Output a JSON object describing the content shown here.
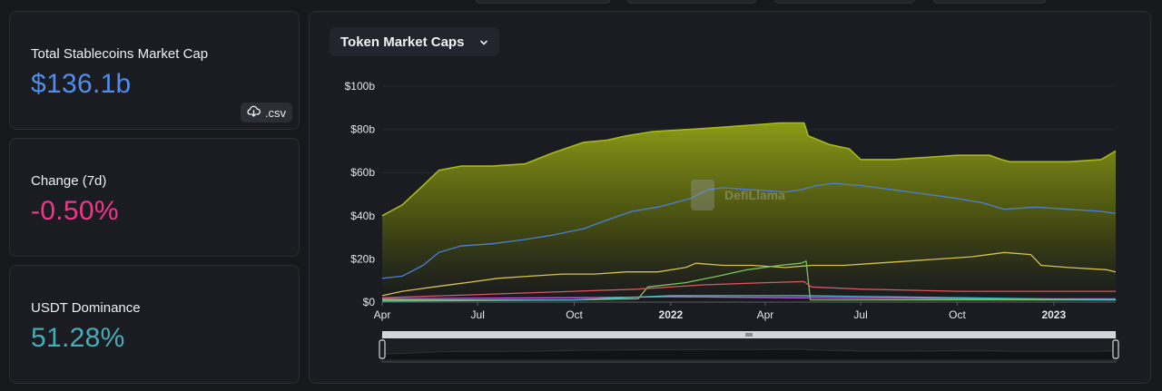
{
  "stats": {
    "total_label": "Total Stablecoins Market Cap",
    "total_value": "$136.1b",
    "csv_label": ".csv",
    "change_label": "Change (7d)",
    "change_value": "-0.50%",
    "dominance_label": "USDT Dominance",
    "dominance_value": "51.28%"
  },
  "colors": {
    "total_value": "#4f8fea",
    "change_value": "#f0358b",
    "dominance_value": "#46acb7"
  },
  "chart": {
    "dropdown_label": "Token Market Caps",
    "watermark": "DefiLlama"
  },
  "chart_data": {
    "type": "area",
    "title": "",
    "xlabel": "",
    "ylabel": "",
    "ylim": [
      0,
      100
    ],
    "y_unit": "b",
    "y_ticks": [
      "$0",
      "$20b",
      "$40b",
      "$60b",
      "$80b",
      "$100b"
    ],
    "y_tick_values": [
      0,
      20,
      40,
      60,
      80,
      100
    ],
    "x_ticks": [
      "Apr",
      "Jul",
      "Oct",
      "2022",
      "Apr",
      "Jul",
      "Oct",
      "2023"
    ],
    "x_tick_dates": [
      "2021-04-01",
      "2021-07-01",
      "2021-10-01",
      "2022-01-01",
      "2022-04-01",
      "2022-07-01",
      "2022-10-01",
      "2023-01-01"
    ],
    "x_range": [
      "2021-04-01",
      "2023-03-01"
    ],
    "grid": true,
    "legend": "none",
    "series": [
      {
        "color": "#a6b81e",
        "fill": true,
        "points": [
          [
            "2021-04-01",
            40
          ],
          [
            "2021-04-20",
            45
          ],
          [
            "2021-05-10",
            54
          ],
          [
            "2021-05-25",
            61
          ],
          [
            "2021-06-15",
            63
          ],
          [
            "2021-07-15",
            63
          ],
          [
            "2021-08-15",
            64
          ],
          [
            "2021-09-10",
            69
          ],
          [
            "2021-10-10",
            74
          ],
          [
            "2021-11-01",
            75
          ],
          [
            "2021-11-20",
            77
          ],
          [
            "2021-12-15",
            79
          ],
          [
            "2022-01-20",
            80
          ],
          [
            "2022-02-20",
            81
          ],
          [
            "2022-03-20",
            82
          ],
          [
            "2022-04-15",
            83
          ],
          [
            "2022-05-08",
            83
          ],
          [
            "2022-05-12",
            77
          ],
          [
            "2022-06-01",
            73
          ],
          [
            "2022-06-20",
            71
          ],
          [
            "2022-07-01",
            66
          ],
          [
            "2022-08-01",
            66
          ],
          [
            "2022-09-01",
            67
          ],
          [
            "2022-10-01",
            68
          ],
          [
            "2022-11-01",
            68
          ],
          [
            "2022-11-12",
            66
          ],
          [
            "2022-11-20",
            65
          ],
          [
            "2022-12-15",
            65
          ],
          [
            "2023-01-15",
            65
          ],
          [
            "2023-02-15",
            66
          ],
          [
            "2023-03-01",
            70
          ]
        ]
      },
      {
        "color": "#4d7ed8",
        "fill": false,
        "points": [
          [
            "2021-04-01",
            11
          ],
          [
            "2021-04-20",
            12
          ],
          [
            "2021-05-10",
            17
          ],
          [
            "2021-05-25",
            23
          ],
          [
            "2021-06-15",
            26
          ],
          [
            "2021-07-15",
            27
          ],
          [
            "2021-08-15",
            29
          ],
          [
            "2021-09-10",
            31
          ],
          [
            "2021-10-10",
            34
          ],
          [
            "2021-11-01",
            38
          ],
          [
            "2021-11-25",
            42
          ],
          [
            "2021-12-20",
            44
          ],
          [
            "2022-01-20",
            48
          ],
          [
            "2022-02-05",
            52
          ],
          [
            "2022-02-20",
            53
          ],
          [
            "2022-03-20",
            52
          ],
          [
            "2022-04-20",
            51
          ],
          [
            "2022-05-05",
            52
          ],
          [
            "2022-05-20",
            54
          ],
          [
            "2022-06-05",
            55
          ],
          [
            "2022-07-01",
            54
          ],
          [
            "2022-08-01",
            52
          ],
          [
            "2022-09-01",
            50
          ],
          [
            "2022-10-01",
            48
          ],
          [
            "2022-10-25",
            46
          ],
          [
            "2022-11-15",
            43
          ],
          [
            "2022-12-15",
            44
          ],
          [
            "2023-01-15",
            43
          ],
          [
            "2023-02-15",
            42
          ],
          [
            "2023-03-01",
            41
          ]
        ]
      },
      {
        "color": "#d6c24a",
        "fill": false,
        "points": [
          [
            "2021-04-01",
            3
          ],
          [
            "2021-04-20",
            5
          ],
          [
            "2021-05-20",
            7
          ],
          [
            "2021-06-20",
            9
          ],
          [
            "2021-07-20",
            11
          ],
          [
            "2021-08-20",
            12
          ],
          [
            "2021-09-20",
            13
          ],
          [
            "2021-10-20",
            13
          ],
          [
            "2021-11-20",
            14
          ],
          [
            "2021-12-20",
            14
          ],
          [
            "2022-01-15",
            16
          ],
          [
            "2022-01-25",
            18
          ],
          [
            "2022-02-20",
            17
          ],
          [
            "2022-03-20",
            17
          ],
          [
            "2022-04-20",
            16
          ],
          [
            "2022-05-15",
            17
          ],
          [
            "2022-06-15",
            17
          ],
          [
            "2022-07-15",
            18
          ],
          [
            "2022-08-15",
            19
          ],
          [
            "2022-09-15",
            20
          ],
          [
            "2022-10-15",
            21
          ],
          [
            "2022-11-15",
            23
          ],
          [
            "2022-12-10",
            22
          ],
          [
            "2022-12-20",
            17
          ],
          [
            "2023-01-15",
            16
          ],
          [
            "2023-02-20",
            15
          ],
          [
            "2023-03-01",
            14
          ]
        ]
      },
      {
        "color": "#7cc45c",
        "fill": false,
        "points": [
          [
            "2021-04-01",
            1
          ],
          [
            "2021-07-01",
            1
          ],
          [
            "2021-10-01",
            1
          ],
          [
            "2021-12-01",
            1.5
          ],
          [
            "2021-12-10",
            7
          ],
          [
            "2022-01-15",
            9
          ],
          [
            "2022-02-15",
            12
          ],
          [
            "2022-03-15",
            15
          ],
          [
            "2022-04-15",
            17
          ],
          [
            "2022-05-05",
            18
          ],
          [
            "2022-05-10",
            19
          ],
          [
            "2022-05-14",
            1
          ],
          [
            "2022-07-01",
            1
          ],
          [
            "2022-10-01",
            1
          ],
          [
            "2023-03-01",
            1
          ]
        ]
      },
      {
        "color": "#d9575f",
        "fill": false,
        "points": [
          [
            "2021-04-01",
            2
          ],
          [
            "2021-06-01",
            3
          ],
          [
            "2021-08-01",
            4
          ],
          [
            "2021-10-01",
            5
          ],
          [
            "2021-12-01",
            6
          ],
          [
            "2022-02-01",
            8
          ],
          [
            "2022-04-01",
            9
          ],
          [
            "2022-05-08",
            9.5
          ],
          [
            "2022-05-15",
            7
          ],
          [
            "2022-07-01",
            6
          ],
          [
            "2022-10-01",
            5
          ],
          [
            "2023-03-01",
            5
          ]
        ]
      },
      {
        "color": "#c75fe0",
        "fill": false,
        "points": [
          [
            "2021-04-01",
            1.5
          ],
          [
            "2021-10-01",
            2
          ],
          [
            "2022-01-01",
            2.5
          ],
          [
            "2022-05-01",
            2
          ],
          [
            "2022-10-01",
            1.5
          ],
          [
            "2023-03-01",
            1.5
          ]
        ]
      },
      {
        "color": "#48c2c6",
        "fill": false,
        "points": [
          [
            "2021-04-01",
            0.5
          ],
          [
            "2021-10-01",
            1
          ],
          [
            "2022-01-01",
            3
          ],
          [
            "2022-05-01",
            3
          ],
          [
            "2022-10-01",
            2
          ],
          [
            "2023-03-01",
            1
          ]
        ]
      }
    ]
  }
}
